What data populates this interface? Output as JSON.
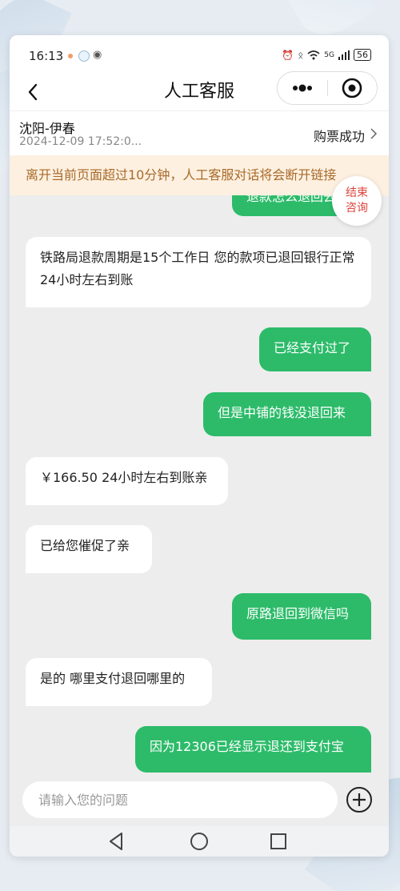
{
  "status_bar": {
    "time": "16:13",
    "network": "5G",
    "battery": "56",
    "icons": [
      "notification-icon",
      "app-icon",
      "wechat-icon",
      "alarm-icon",
      "bluetooth-icon",
      "wifi-icon",
      "signal-icon",
      "battery-icon"
    ]
  },
  "header": {
    "title": "人工客服",
    "back_icon": "chevron-left-icon",
    "more_icon": "more-dots-icon",
    "close_icon": "target-close-icon"
  },
  "order": {
    "route": "沈阳-伊春",
    "datetime": "2024-12-09 17:52:0...",
    "status": "购票成功"
  },
  "notice": {
    "text": "离开当前页面超过10分钟，人工客服对话将会断开链接"
  },
  "end_chat": {
    "line1": "结束",
    "line2": "咨询"
  },
  "messages": [
    {
      "side": "right",
      "text": "退款怎么退回去"
    },
    {
      "side": "left",
      "text": "铁路局退款周期是15个工作日 您的款项已退回银行正常24小时左右到账"
    },
    {
      "side": "right",
      "text": "已经支付过了"
    },
    {
      "side": "right",
      "text": "但是中铺的钱没退回来"
    },
    {
      "side": "left",
      "text": "￥166.50 24小时左右到账亲"
    },
    {
      "side": "left",
      "text": "已给您催促了亲"
    },
    {
      "side": "right",
      "text": "原路退回到微信吗"
    },
    {
      "side": "left",
      "text": "是的 哪里支付退回哪里的"
    },
    {
      "side": "right",
      "text": "因为12306已经显示退还到支付宝"
    }
  ],
  "input": {
    "placeholder": "请输入您的问题",
    "value": ""
  },
  "colors": {
    "accent_green": "#2dbb6a",
    "notice_bg": "#fdf0e0",
    "notice_text": "#a86a2a",
    "end_button_text": "#e0433a"
  }
}
